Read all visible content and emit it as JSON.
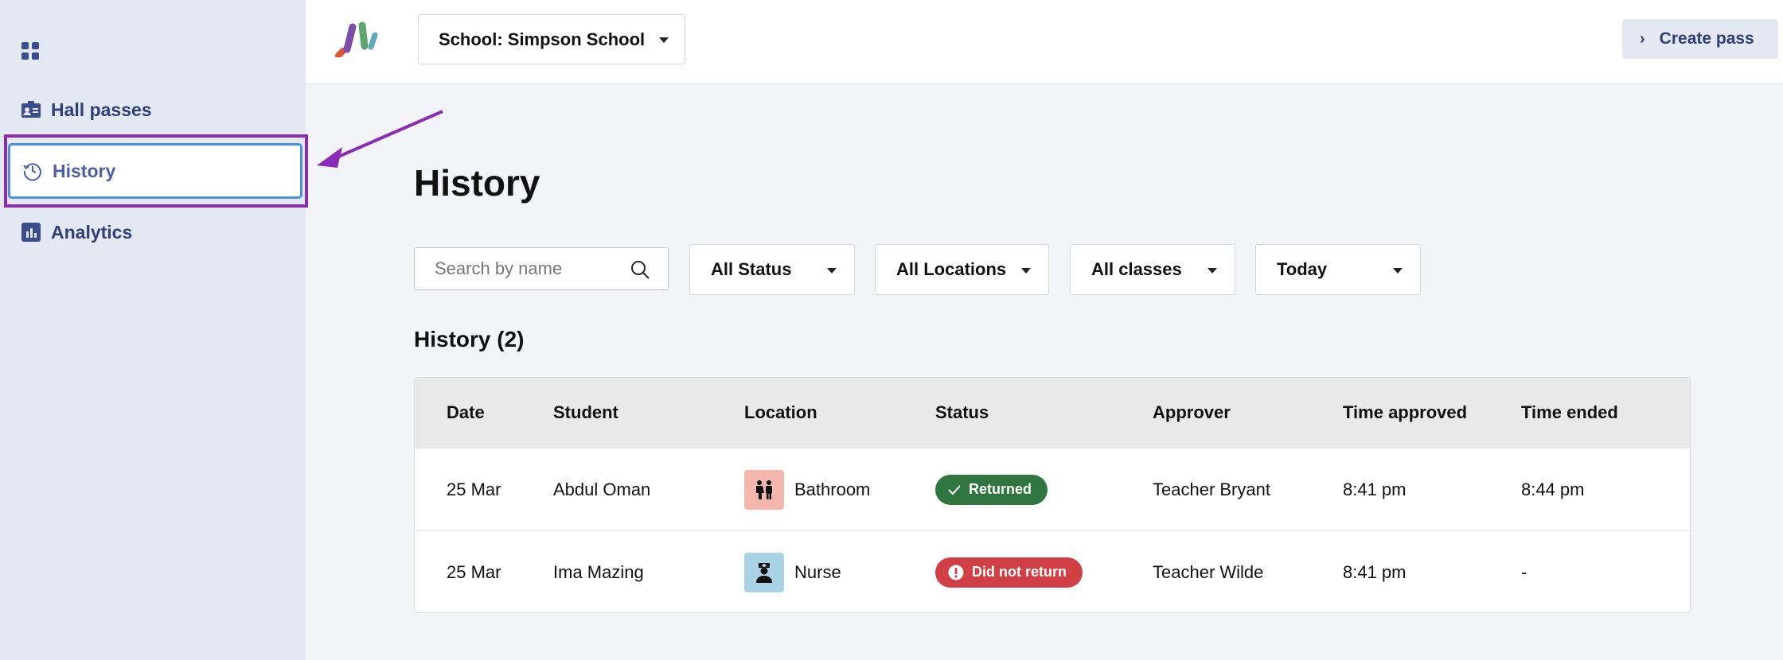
{
  "sidebar": {
    "items": [
      {
        "label": "Hall passes",
        "icon": "id-card-icon"
      },
      {
        "label": "History",
        "icon": "history-icon"
      },
      {
        "label": "Analytics",
        "icon": "bar-chart-icon"
      }
    ]
  },
  "header": {
    "school_select": "School: Simpson School",
    "create_button": "Create pass"
  },
  "main": {
    "title": "History",
    "search_placeholder": "Search by name",
    "filters": [
      "All Status",
      "All Locations",
      "All classes",
      "Today"
    ],
    "section_title": "History (2)",
    "columns": [
      "Date",
      "Student",
      "Location",
      "Status",
      "Approver",
      "Time approved",
      "Time ended"
    ],
    "rows": [
      {
        "date": "25 Mar",
        "student": "Abdul Oman",
        "location": "Bathroom",
        "location_icon": "restroom-icon",
        "status": "Returned",
        "status_color": "#2e7540",
        "approver": "Teacher Bryant",
        "time_approved": "8:41 pm",
        "time_ended": "8:44 pm"
      },
      {
        "date": "25 Mar",
        "student": "Ima Mazing",
        "location": "Nurse",
        "location_icon": "nurse-icon",
        "status": "Did not return",
        "status_color": "#cf3f44",
        "approver": "Teacher Wilde",
        "time_approved": "8:41 pm",
        "time_ended": "-"
      }
    ]
  },
  "colors": {
    "accent": "#2f3f76",
    "highlight": "#8a2cb6",
    "selected_border": "#4a90e2"
  }
}
